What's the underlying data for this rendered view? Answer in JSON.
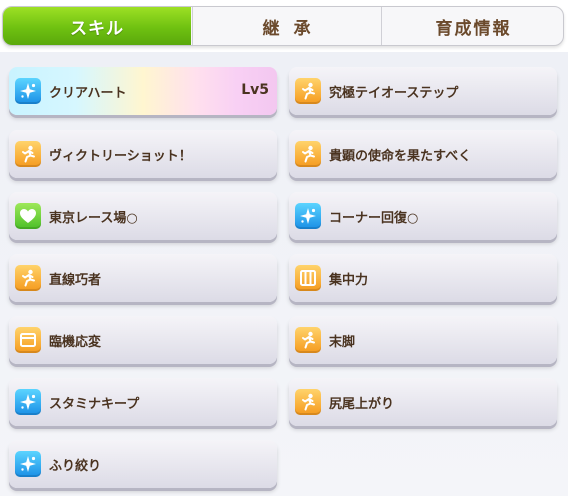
{
  "tabs": {
    "skill": "スキル",
    "inherit": "継承",
    "training_info": "育成情報"
  },
  "skills_left": [
    {
      "name": "クリアハート",
      "level": "Lv5",
      "icon": "sparkle-icon",
      "icon_color": "blue"
    },
    {
      "name": "ヴィクトリーショット！",
      "icon": "runner-icon",
      "icon_color": "orange"
    },
    {
      "name": "東京レース場○",
      "icon": "heart-icon",
      "icon_color": "green"
    },
    {
      "name": "直線巧者",
      "icon": "runner-icon",
      "icon_color": "orange"
    },
    {
      "name": "臨機応変",
      "icon": "window-icon",
      "icon_color": "orange"
    },
    {
      "name": "スタミナキープ",
      "icon": "sparkle-icon",
      "icon_color": "blue"
    },
    {
      "name": "ふり絞り",
      "icon": "sparkle-icon",
      "icon_color": "blue"
    }
  ],
  "skills_right": [
    {
      "name": "究極テイオーステップ",
      "icon": "runner-icon",
      "icon_color": "orange"
    },
    {
      "name": "貴顕の使命を果たすべく",
      "icon": "runner-icon",
      "icon_color": "orange"
    },
    {
      "name": "コーナー回復○",
      "icon": "sparkle-icon",
      "icon_color": "blue"
    },
    {
      "name": "集中力",
      "icon": "gate-icon",
      "icon_color": "orange"
    },
    {
      "name": "末脚",
      "icon": "runner-icon",
      "icon_color": "orange"
    },
    {
      "name": "尻尾上がり",
      "icon": "runner-icon",
      "icon_color": "orange"
    }
  ],
  "colors": {
    "active_tab": "#6fc111",
    "text": "#4a3320"
  }
}
